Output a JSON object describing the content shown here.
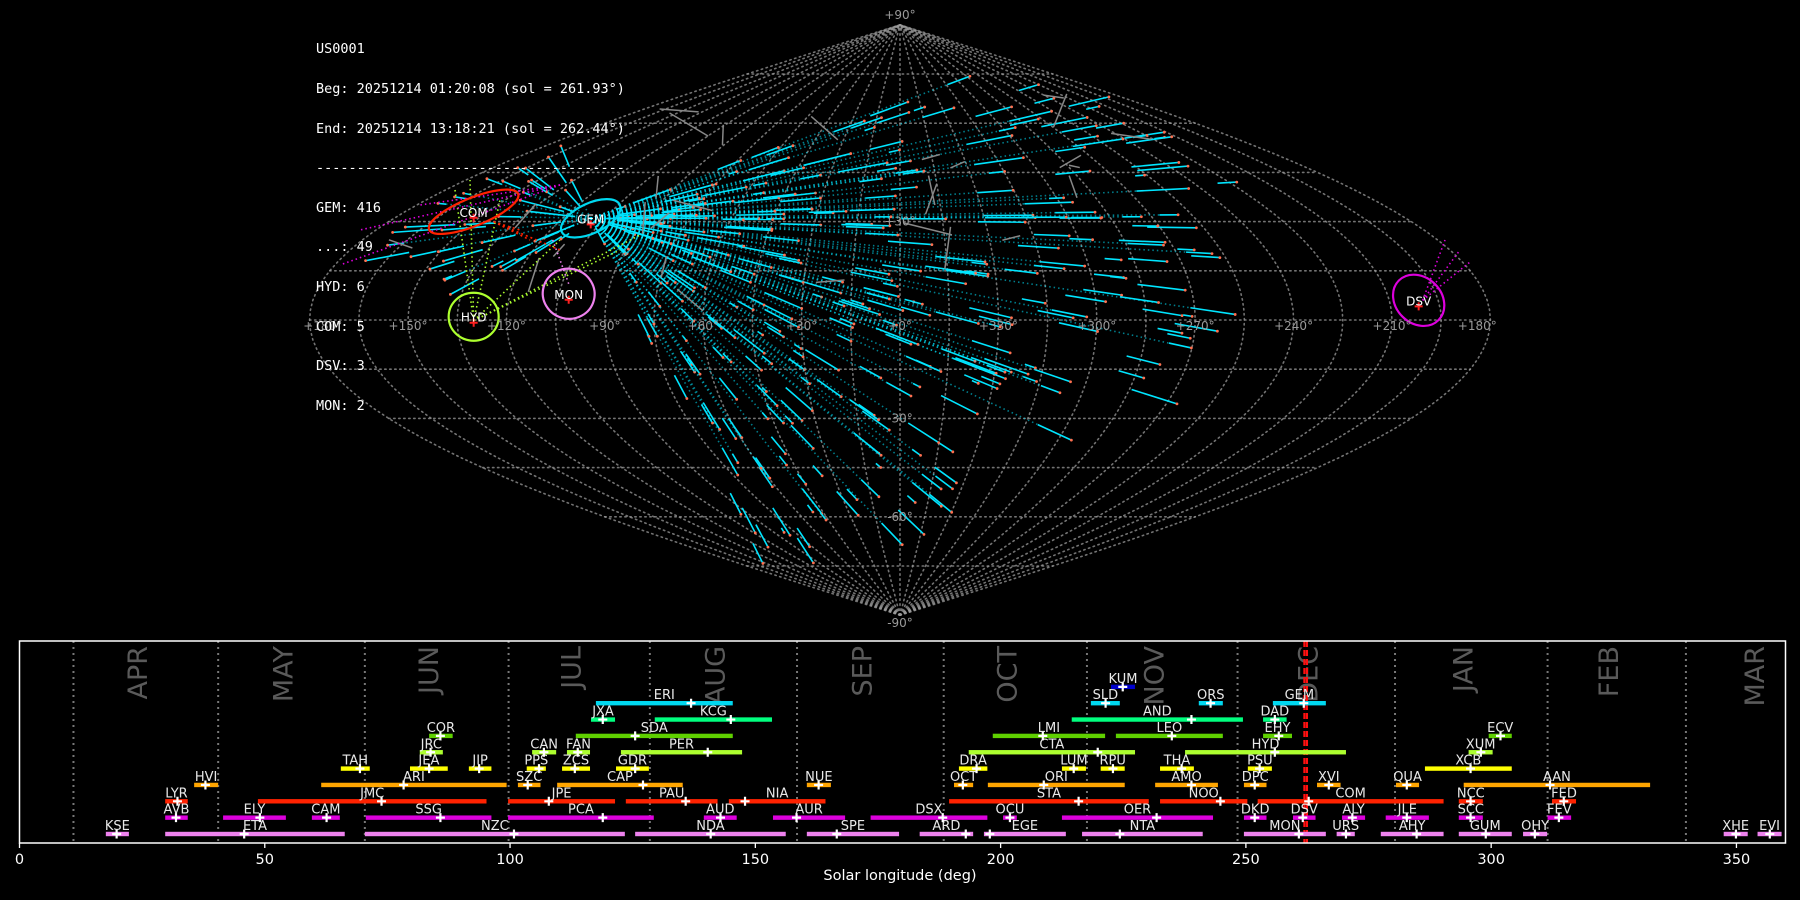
{
  "info_box": {
    "station": "US0001",
    "begin": "Beg: 20251214 01:20:08 (sol = 261.93°)",
    "end": "End: 20251214 13:18:21 (sol = 262.44°)",
    "separator": "--------------------------------------",
    "counts": [
      {
        "shower": "GEM",
        "count": "416"
      },
      {
        "shower": "...",
        "count": "49"
      },
      {
        "shower": "HYD",
        "count": "6"
      },
      {
        "shower": "COM",
        "count": "5"
      },
      {
        "shower": "DSV",
        "count": "3"
      },
      {
        "shower": "MON",
        "count": "2"
      }
    ]
  },
  "chart_data": [
    {
      "type": "scatter",
      "projection": "sinusoidal",
      "lon_tick_labels": [
        "+180",
        "+150",
        "+120",
        "+90",
        "+60",
        "+30",
        "+0",
        "+330",
        "+300",
        "+270",
        "+240",
        "+210",
        "+180"
      ],
      "lat_tick_labels": [
        "+90",
        "+30",
        "-30",
        "-60",
        "-90"
      ],
      "grid": true,
      "radiants": [
        {
          "name": "COM",
          "ra": 155,
          "dec": 33,
          "color": "#ff2200"
        },
        {
          "name": "GEM",
          "ra": 110,
          "dec": 31,
          "color": "#00d8f0"
        },
        {
          "name": "HYD",
          "ra": 130,
          "dec": 1,
          "color": "#adff2f"
        },
        {
          "name": "MON",
          "ra": 102,
          "dec": 8,
          "color": "#ee82ee"
        },
        {
          "name": "DSV",
          "ra": 201,
          "dec": 6,
          "color": "#dd00dd"
        }
      ],
      "trail_colors": {
        "GEM": "#00e5ff",
        "sporadic": "#888888",
        "HYD": "#adff2f",
        "DSV": "#dd00dd",
        "COM": "#ff2200",
        "MON": "#ee82ee"
      }
    },
    {
      "type": "bar",
      "subtype": "range",
      "xlabel": "Solar longitude (deg)",
      "xlim": [
        0,
        360
      ],
      "xticks": [
        0,
        50,
        100,
        150,
        200,
        250,
        300,
        350
      ],
      "month_boundaries": [
        11.0,
        40.5,
        70.4,
        99.7,
        128.5,
        158.5,
        188.4,
        217.6,
        248.3,
        280.4,
        311.5,
        339.7
      ],
      "months": [
        "APR",
        "MAY",
        "JUN",
        "JUL",
        "AUG",
        "SEP",
        "OCT",
        "NOV",
        "DEC",
        "JAN",
        "FEB",
        "MAR"
      ],
      "observation_window": [
        261.93,
        262.44
      ],
      "row_colors": [
        "#ee82ee",
        "#dd00dd",
        "#ff2200",
        "#ffa500",
        "#ffff00",
        "#adff2f",
        "#5fd000",
        "#00ff7f",
        "#00d8f0",
        "#0000cc"
      ],
      "showers": [
        {
          "code": "KSE",
          "row": 0,
          "start": 17.6,
          "peak": 19.8,
          "end": 22.3
        },
        {
          "code": "ETA",
          "row": 0,
          "start": 29.7,
          "peak": 45.8,
          "end": 66.3
        },
        {
          "code": "NZC",
          "row": 0,
          "start": 70.4,
          "peak": 100.8,
          "end": 123.4
        },
        {
          "code": "NDA",
          "row": 0,
          "start": 125.5,
          "peak": 140.9,
          "end": 156.2
        },
        {
          "code": "SPE",
          "row": 0,
          "start": 160.5,
          "peak": 166.6,
          "end": 179.3
        },
        {
          "code": "ARD",
          "row": 0,
          "start": 183.5,
          "peak": 192.9,
          "end": 194.4
        },
        {
          "code": "EGE",
          "row": 0,
          "start": 196.6,
          "peak": 197.8,
          "end": 213.3
        },
        {
          "code": "NTA",
          "row": 0,
          "start": 216.6,
          "peak": 224.3,
          "end": 241.2
        },
        {
          "code": "MON",
          "row": 0,
          "start": 249.6,
          "peak": 260.8,
          "end": 266.3
        },
        {
          "code": "URS",
          "row": 0,
          "start": 268.5,
          "peak": 270.4,
          "end": 272.2
        },
        {
          "code": "AHY",
          "row": 0,
          "start": 277.5,
          "peak": 284.8,
          "end": 290.3
        },
        {
          "code": "GUM",
          "row": 0,
          "start": 293.4,
          "peak": 298.9,
          "end": 304.2
        },
        {
          "code": "OHY",
          "row": 0,
          "start": 306.5,
          "peak": 308.9,
          "end": 311.4
        },
        {
          "code": "XHE",
          "row": 0,
          "start": 347.4,
          "peak": 349.9,
          "end": 352.3
        },
        {
          "code": "EVI",
          "row": 0,
          "start": 354.3,
          "peak": 356.8,
          "end": 359.2
        },
        {
          "code": "AVB",
          "row": 1,
          "start": 29.7,
          "peak": 31.9,
          "end": 34.3
        },
        {
          "code": "ELY",
          "row": 1,
          "start": 41.5,
          "peak": 49.0,
          "end": 54.3
        },
        {
          "code": "CAM",
          "row": 1,
          "start": 59.6,
          "peak": 62.6,
          "end": 65.3
        },
        {
          "code": "SSG",
          "row": 1,
          "start": 70.6,
          "peak": 85.8,
          "end": 96.2
        },
        {
          "code": "PCA",
          "row": 1,
          "start": 99.6,
          "peak": 118.9,
          "end": 129.3
        },
        {
          "code": "AUD",
          "row": 1,
          "start": 139.5,
          "peak": 142.9,
          "end": 146.2
        },
        {
          "code": "AUR",
          "row": 1,
          "start": 153.6,
          "peak": 158.4,
          "end": 168.3
        },
        {
          "code": "DSX",
          "row": 1,
          "start": 173.5,
          "peak": 188.2,
          "end": 197.3
        },
        {
          "code": "OCU",
          "row": 1,
          "start": 200.5,
          "peak": 201.9,
          "end": 203.3
        },
        {
          "code": "OER",
          "row": 1,
          "start": 212.5,
          "peak": 231.8,
          "end": 243.3
        },
        {
          "code": "DKD",
          "row": 1,
          "start": 249.6,
          "peak": 251.8,
          "end": 254.2
        },
        {
          "code": "DSV",
          "row": 1,
          "start": 259.6,
          "peak": 261.6,
          "end": 264.2
        },
        {
          "code": "ALY",
          "row": 1,
          "start": 269.6,
          "peak": 271.7,
          "end": 274.3
        },
        {
          "code": "JLE",
          "row": 1,
          "start": 278.5,
          "peak": 282.8,
          "end": 287.3
        },
        {
          "code": "SCC",
          "row": 1,
          "start": 293.4,
          "peak": 295.8,
          "end": 298.3
        },
        {
          "code": "FEV",
          "row": 1,
          "start": 311.5,
          "peak": 313.8,
          "end": 316.3
        },
        {
          "code": "LYR",
          "row": 2,
          "start": 29.7,
          "peak": 32.2,
          "end": 34.3
        },
        {
          "code": "JMC",
          "row": 2,
          "start": 48.6,
          "peak": 73.8,
          "end": 95.2
        },
        {
          "code": "JPE",
          "row": 2,
          "start": 99.6,
          "peak": 107.9,
          "end": 121.4
        },
        {
          "code": "PAU",
          "row": 2,
          "start": 123.6,
          "peak": 135.8,
          "end": 142.3
        },
        {
          "code": "NIA",
          "row": 2,
          "start": 144.6,
          "peak": 147.9,
          "end": 164.3
        },
        {
          "code": "STA",
          "row": 2,
          "start": 189.5,
          "peak": 215.9,
          "end": 230.2
        },
        {
          "code": "NOO",
          "row": 2,
          "start": 232.5,
          "peak": 244.8,
          "end": 250.3
        },
        {
          "code": "COM",
          "row": 2,
          "start": 252.4,
          "peak": 262.8,
          "end": 290.3
        },
        {
          "code": "NCC",
          "row": 2,
          "start": 293.4,
          "peak": 295.8,
          "end": 298.3
        },
        {
          "code": "FED",
          "row": 2,
          "start": 312.4,
          "peak": 314.8,
          "end": 317.3
        },
        {
          "code": "HVI",
          "row": 3,
          "start": 35.6,
          "peak": 37.9,
          "end": 40.5
        },
        {
          "code": "ARI",
          "row": 3,
          "start": 61.5,
          "peak": 78.3,
          "end": 99.3
        },
        {
          "code": "SZC",
          "row": 3,
          "start": 101.6,
          "peak": 103.6,
          "end": 106.2
        },
        {
          "code": "CAP",
          "row": 3,
          "start": 109.6,
          "peak": 127.1,
          "end": 135.2
        },
        {
          "code": "NUE",
          "row": 3,
          "start": 160.5,
          "peak": 162.9,
          "end": 165.4
        },
        {
          "code": "OCT",
          "row": 3,
          "start": 190.5,
          "peak": 192.3,
          "end": 194.4
        },
        {
          "code": "ORI",
          "row": 3,
          "start": 197.4,
          "peak": 208.8,
          "end": 225.3
        },
        {
          "code": "AMO",
          "row": 3,
          "start": 231.5,
          "peak": 238.9,
          "end": 244.3
        },
        {
          "code": "DPC",
          "row": 3,
          "start": 249.6,
          "peak": 251.8,
          "end": 254.2
        },
        {
          "code": "XVI",
          "row": 3,
          "start": 264.5,
          "peak": 266.9,
          "end": 269.3
        },
        {
          "code": "QUA",
          "row": 3,
          "start": 280.6,
          "peak": 282.8,
          "end": 285.3
        },
        {
          "code": "AAN",
          "row": 3,
          "start": 294.4,
          "peak": 312.0,
          "end": 332.4
        },
        {
          "code": "TAH",
          "row": 4,
          "start": 65.5,
          "peak": 69.4,
          "end": 71.4
        },
        {
          "code": "JEA",
          "row": 4,
          "start": 79.6,
          "peak": 83.5,
          "end": 87.3
        },
        {
          "code": "JIP",
          "row": 4,
          "start": 91.6,
          "peak": 93.7,
          "end": 96.2
        },
        {
          "code": "PPS",
          "row": 4,
          "start": 103.4,
          "peak": 105.9,
          "end": 107.3
        },
        {
          "code": "ZCS",
          "row": 4,
          "start": 110.6,
          "peak": 113.2,
          "end": 116.3
        },
        {
          "code": "GDR",
          "row": 4,
          "start": 121.6,
          "peak": 125.5,
          "end": 128.3
        },
        {
          "code": "DRA",
          "row": 4,
          "start": 191.5,
          "peak": 195.1,
          "end": 197.3
        },
        {
          "code": "LUM",
          "row": 4,
          "start": 212.5,
          "peak": 214.9,
          "end": 217.4
        },
        {
          "code": "RPU",
          "row": 4,
          "start": 220.4,
          "peak": 222.9,
          "end": 225.3
        },
        {
          "code": "THA",
          "row": 4,
          "start": 232.5,
          "peak": 236.9,
          "end": 239.4
        },
        {
          "code": "PSU",
          "row": 4,
          "start": 250.4,
          "peak": 252.8,
          "end": 255.3
        },
        {
          "code": "XCB",
          "row": 4,
          "start": 286.5,
          "peak": 295.8,
          "end": 304.2
        },
        {
          "code": "JRC",
          "row": 5,
          "start": 81.6,
          "peak": 83.8,
          "end": 86.3
        },
        {
          "code": "CAN",
          "row": 5,
          "start": 104.5,
          "peak": 106.9,
          "end": 109.4
        },
        {
          "code": "FAN",
          "row": 5,
          "start": 111.6,
          "peak": 113.8,
          "end": 116.3
        },
        {
          "code": "PER",
          "row": 5,
          "start": 122.6,
          "peak": 140.3,
          "end": 147.3
        },
        {
          "code": "CTA",
          "row": 5,
          "start": 193.5,
          "peak": 219.8,
          "end": 227.4
        },
        {
          "code": "HYD",
          "row": 5,
          "start": 237.6,
          "peak": 255.9,
          "end": 270.4
        },
        {
          "code": "XUM",
          "row": 5,
          "start": 295.4,
          "peak": 297.9,
          "end": 300.3
        },
        {
          "code": "COR",
          "row": 6,
          "start": 83.5,
          "peak": 85.8,
          "end": 88.3
        },
        {
          "code": "SDA",
          "row": 6,
          "start": 113.4,
          "peak": 125.5,
          "end": 145.4
        },
        {
          "code": "LMI",
          "row": 6,
          "start": 198.4,
          "peak": 208.6,
          "end": 221.3
        },
        {
          "code": "LEO",
          "row": 6,
          "start": 223.5,
          "peak": 234.9,
          "end": 245.3
        },
        {
          "code": "EHY",
          "row": 6,
          "start": 253.5,
          "peak": 256.7,
          "end": 259.4
        },
        {
          "code": "ECV",
          "row": 6,
          "start": 299.5,
          "peak": 301.9,
          "end": 304.2
        },
        {
          "code": "JXA",
          "row": 7,
          "start": 116.5,
          "peak": 118.9,
          "end": 121.4
        },
        {
          "code": "KCG",
          "row": 7,
          "start": 129.5,
          "peak": 145.0,
          "end": 153.4
        },
        {
          "code": "AND",
          "row": 7,
          "start": 214.5,
          "peak": 238.9,
          "end": 249.4
        },
        {
          "code": "DAD",
          "row": 7,
          "start": 253.5,
          "peak": 255.9,
          "end": 258.3
        },
        {
          "code": "ERI",
          "row": 8,
          "start": 117.5,
          "peak": 136.9,
          "end": 145.4
        },
        {
          "code": "SLD",
          "row": 8,
          "start": 218.4,
          "peak": 221.4,
          "end": 224.3
        },
        {
          "code": "ORS",
          "row": 8,
          "start": 240.4,
          "peak": 242.8,
          "end": 245.3
        },
        {
          "code": "GEM",
          "row": 8,
          "start": 255.5,
          "peak": 261.8,
          "end": 266.3
        },
        {
          "code": "KUM",
          "row": 9,
          "start": 222.5,
          "peak": 224.9,
          "end": 227.4
        }
      ]
    }
  ]
}
